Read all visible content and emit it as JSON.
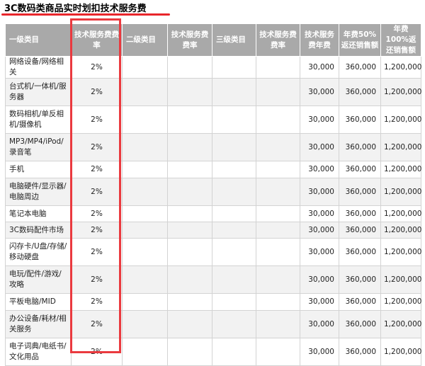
{
  "title": "3C数码类商品实时划扣技术服务费",
  "headers": [
    "一级类目",
    "技术服务费费率",
    "二级类目",
    "技术服务费费率",
    "三级类目",
    "技术服务费费率",
    "技术服务费年费",
    "年费50%返还销售额",
    "年费100%返还销售额"
  ],
  "rows": [
    {
      "category": "网络设备/网络相关",
      "rate": "2%",
      "annual_fee": "30,000",
      "refund_50": "360,000",
      "refund_100": "1,200,000"
    },
    {
      "category": "台式机/一体机/服务器",
      "rate": "2%",
      "annual_fee": "30,000",
      "refund_50": "360,000",
      "refund_100": "1,200,000"
    },
    {
      "category": "数码相机/单反相机/摄像机",
      "rate": "2%",
      "annual_fee": "30,000",
      "refund_50": "360,000",
      "refund_100": "1,200,000"
    },
    {
      "category": "MP3/MP4/iPod/录音笔",
      "rate": "2%",
      "annual_fee": "30,000",
      "refund_50": "360,000",
      "refund_100": "1,200,000"
    },
    {
      "category": "手机",
      "rate": "2%",
      "annual_fee": "30,000",
      "refund_50": "360,000",
      "refund_100": "1,200,000"
    },
    {
      "category": "电脑硬件/显示器/电脑周边",
      "rate": "2%",
      "annual_fee": "30,000",
      "refund_50": "360,000",
      "refund_100": "1,200,000"
    },
    {
      "category": "笔记本电脑",
      "rate": "2%",
      "annual_fee": "30,000",
      "refund_50": "360,000",
      "refund_100": "1,200,000"
    },
    {
      "category": "3C数码配件市场",
      "rate": "2%",
      "annual_fee": "30,000",
      "refund_50": "360,000",
      "refund_100": "1,200,000"
    },
    {
      "category": "闪存卡/U盘/存储/移动硬盘",
      "rate": "2%",
      "annual_fee": "30,000",
      "refund_50": "360,000",
      "refund_100": "1,200,000"
    },
    {
      "category": "电玩/配件/游戏/攻略",
      "rate": "2%",
      "annual_fee": "30,000",
      "refund_50": "360,000",
      "refund_100": "1,200,000"
    },
    {
      "category": "平板电脑/MID",
      "rate": "2%",
      "annual_fee": "30,000",
      "refund_50": "360,000",
      "refund_100": "1,200,000"
    },
    {
      "category": "办公设备/耗材/相关服务",
      "rate": "2%",
      "annual_fee": "30,000",
      "refund_50": "360,000",
      "refund_100": "1,200,000"
    },
    {
      "category": "电子词典/电纸书/文化用品",
      "rate": "2%",
      "annual_fee": "30,000",
      "refund_50": "360,000",
      "refund_100": "1,200,000"
    }
  ],
  "colors": {
    "header_bg": "#a9a9a9",
    "highlight": "#ea3a3f",
    "underline": "#e8262b",
    "row_alt": "#f2f2f2"
  }
}
